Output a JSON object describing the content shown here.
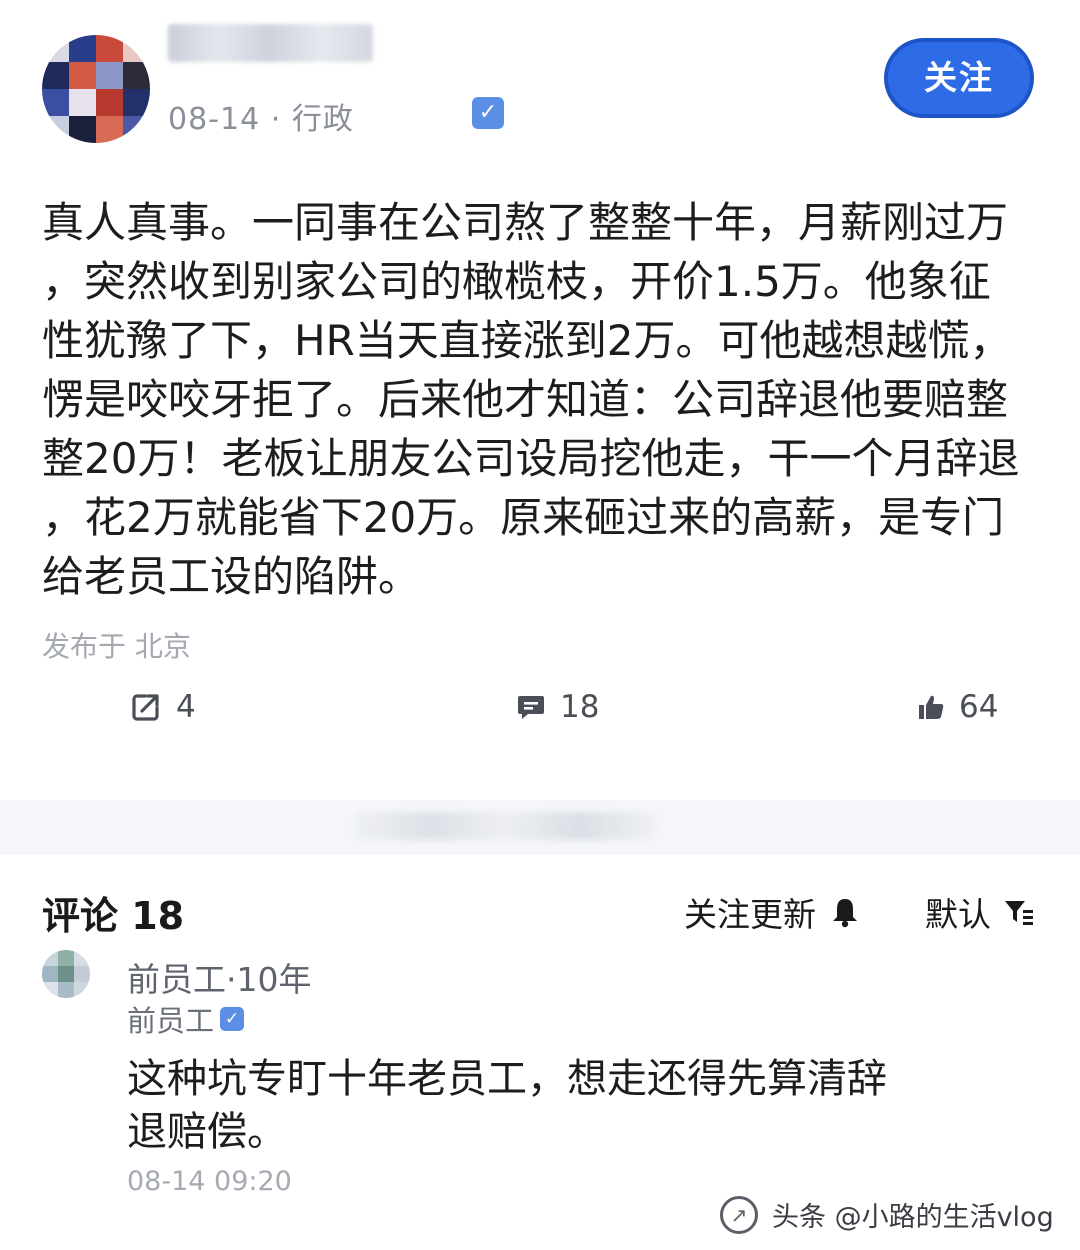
{
  "post": {
    "date": "08-14",
    "separator": "·",
    "category": "行政",
    "follow_label": "关注",
    "body_lines": [
      "真人真事。一同事在公司熬了整整十年，月薪刚过万",
      "，突然收到别家公司的橄榄枝，开价1.5万。他象征",
      "性犹豫了下，HR当天直接涨到2万。可他越想越慌，",
      "愣是咬咬牙拒了。后来他才知道：公司辞退他要赔整",
      "整20万！老板让朋友公司设局挖他走，干一个月辞退",
      "，花2万就能省下20万。原来砸过来的高薪，是专门",
      "给老员工设的陷阱。"
    ],
    "location": "发布于 北京",
    "actions": {
      "share_count": "4",
      "comment_count": "18",
      "like_count": "64"
    }
  },
  "comments": {
    "title": "评论 18",
    "follow_updates_label": "关注更新",
    "sort_label": "默认",
    "items": [
      {
        "name_line": "前员工·10年",
        "badge_name": "前员工",
        "text_lines": [
          "这种坑专盯十年老员工，想走还得先算清辞",
          "退赔偿。"
        ],
        "time": "08-14 09:20"
      }
    ]
  },
  "watermark": {
    "text": "头条 @小路的生活vlog"
  },
  "icons": {
    "verified": "check-badge-icon",
    "share": "share-icon",
    "comment": "comment-icon",
    "like": "thumbs-up-icon",
    "bell": "bell-icon",
    "filter": "filter-icon"
  },
  "colors": {
    "accent_blue": "#2e6be6",
    "verified_blue": "#5b8fe6",
    "muted_text": "#8a8f99"
  }
}
